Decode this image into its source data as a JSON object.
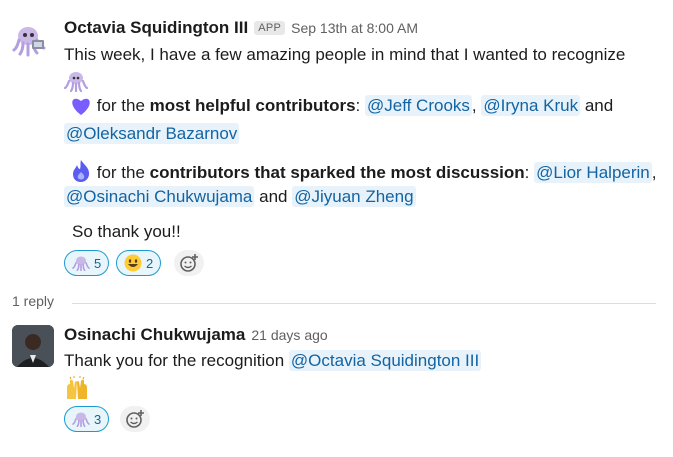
{
  "message1": {
    "author": "Octavia Squidington III",
    "badge": "APP",
    "timestamp": "Sep 13th at 8:00 AM",
    "intro": "This week, I have a few amazing people in mind that I wanted to recognize",
    "helpful": {
      "prefix": " for the ",
      "bold": "most helpful contributors",
      "colon": ": ",
      "mentions": [
        "@Jeff Crooks",
        "@Iryna Kruk",
        "@Oleksandr Bazarnov"
      ],
      "sep1": ", ",
      "sep2": " and"
    },
    "discussion": {
      "prefix": " for the ",
      "bold": "contributors that sparked the most discussion",
      "colon": ": ",
      "mentions": [
        "@Lior Halperin",
        "@Osinachi Chukwujama",
        "@Jiyuan Zheng"
      ],
      "sep1": ",",
      "sep2": " and "
    },
    "closing": "So thank you!!",
    "reactions": [
      {
        "emoji": "octopus",
        "count": "5"
      },
      {
        "emoji": "grinning-face",
        "count": "2"
      }
    ]
  },
  "thread": {
    "reply_count": "1 reply"
  },
  "message2": {
    "author": "Osinachi Chukwujama",
    "timestamp": "21 days ago",
    "text": "Thank you for the recognition ",
    "mention": "@Octavia Squidington III",
    "reactions": [
      {
        "emoji": "octopus",
        "count": "3"
      }
    ]
  },
  "colors": {
    "mention": "#1264a3",
    "mention_bg": "#e8f2fa",
    "reaction_border": "#1d9bd1",
    "heart": "#7b5cff",
    "fire": "#5b5cf0"
  }
}
